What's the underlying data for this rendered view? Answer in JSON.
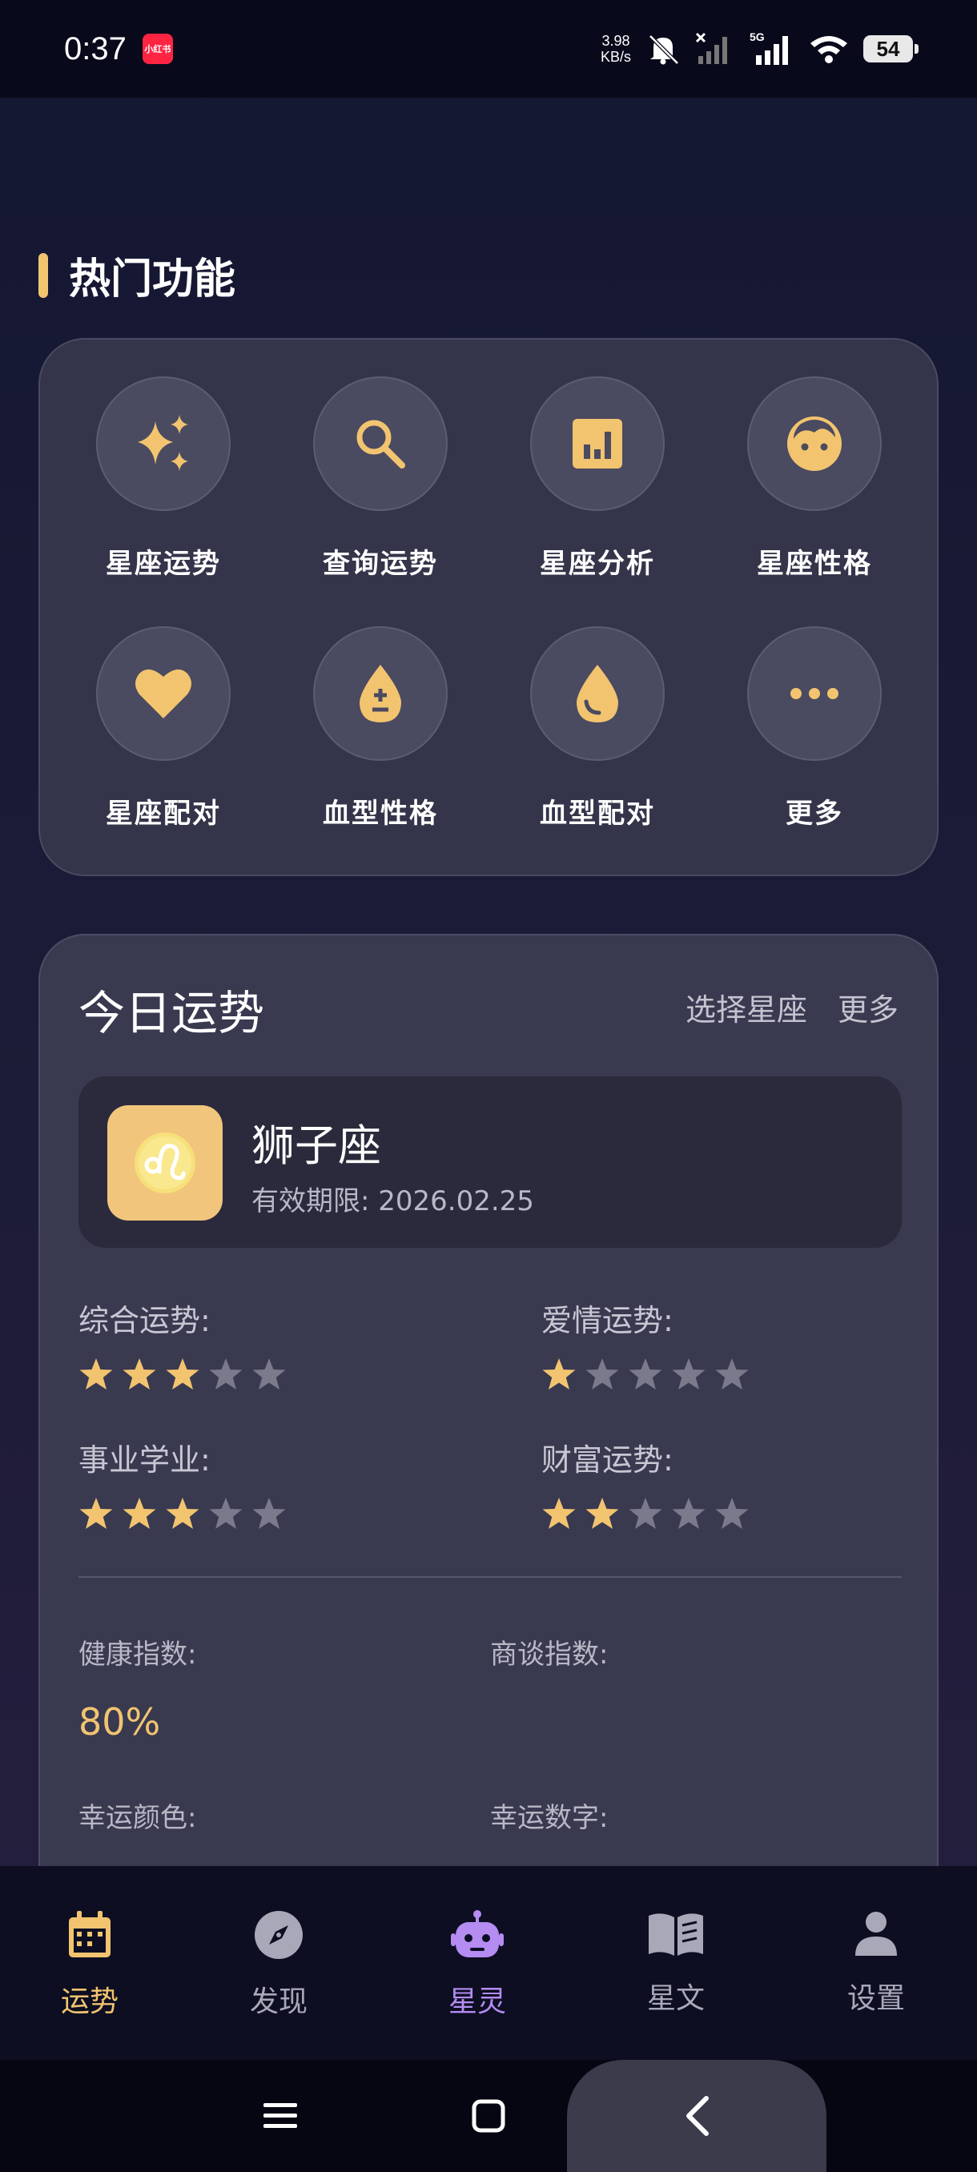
{
  "status_bar": {
    "time": "0:37",
    "notification_badge": "小红书",
    "net_speed_value": "3.98",
    "net_speed_unit": "KB/s",
    "network": "5G",
    "battery": "54"
  },
  "hot_features": {
    "title": "热门功能",
    "items": [
      {
        "label": "星座运势",
        "icon": "sparkles-icon"
      },
      {
        "label": "查询运势",
        "icon": "search-icon"
      },
      {
        "label": "星座分析",
        "icon": "bar-chart-icon"
      },
      {
        "label": "星座性格",
        "icon": "face-icon"
      },
      {
        "label": "星座配对",
        "icon": "heart-icon"
      },
      {
        "label": "血型性格",
        "icon": "blood-drop-plus-minus-icon"
      },
      {
        "label": "血型配对",
        "icon": "blood-drop-icon"
      },
      {
        "label": "更多",
        "icon": "more-dots-icon"
      }
    ]
  },
  "fortune": {
    "title": "今日运势",
    "select_sign": "选择星座",
    "more": "更多",
    "sign": {
      "name": "狮子座",
      "validity": "有效期限: 2026.02.25",
      "icon": "leo-icon"
    },
    "ratings": [
      {
        "label": "综合运势:",
        "stars": 3,
        "max": 5
      },
      {
        "label": "爱情运势:",
        "stars": 1,
        "max": 5
      },
      {
        "label": "事业学业:",
        "stars": 3,
        "max": 5
      },
      {
        "label": "财富运势:",
        "stars": 2,
        "max": 5
      }
    ],
    "indices": [
      {
        "label": "健康指数:",
        "value": "80%"
      },
      {
        "label": "商谈指数:",
        "value": ""
      },
      {
        "label": "幸运颜色:",
        "value": ""
      },
      {
        "label": "幸运数字:",
        "value": ""
      }
    ]
  },
  "tabs": [
    {
      "label": "运势",
      "icon": "calendar-icon",
      "state": "active-yellow"
    },
    {
      "label": "发现",
      "icon": "compass-icon",
      "state": ""
    },
    {
      "label": "星灵",
      "icon": "robot-icon",
      "state": "active-purple"
    },
    {
      "label": "星文",
      "icon": "book-icon",
      "state": ""
    },
    {
      "label": "设置",
      "icon": "person-icon",
      "state": ""
    }
  ],
  "colors": {
    "accent_gold": "#f2c46f",
    "accent_purple": "#b48cf2",
    "star_off": "#7a7a8c",
    "card_bg": "#34344a"
  }
}
